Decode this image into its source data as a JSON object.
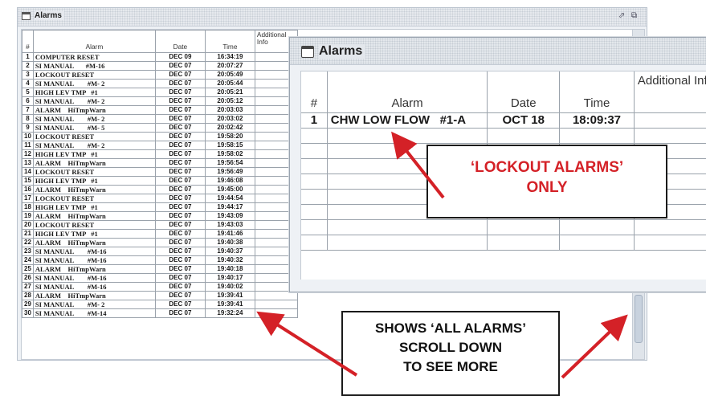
{
  "back_window": {
    "title": "Alarms",
    "controls": {
      "restore": "⬀",
      "maximize": "⧉"
    },
    "columns": [
      "#",
      "Alarm",
      "Date",
      "Time",
      "Additional Info"
    ],
    "rows": [
      [
        "1",
        "COMPUTER RESET",
        "DEC 09",
        "16:34:19"
      ],
      [
        "2",
        "SI MANUAL       #M-16",
        "DEC 07",
        "20:07:27"
      ],
      [
        "3",
        "LOCKOUT RESET",
        "DEC 07",
        "20:05:49"
      ],
      [
        "4",
        "SI MANUAL        #M- 2",
        "DEC 07",
        "20:05:44"
      ],
      [
        "5",
        "HIGH LEV TMP   #1",
        "DEC 07",
        "20:05:21"
      ],
      [
        "6",
        "SI MANUAL        #M- 2",
        "DEC 07",
        "20:05:12"
      ],
      [
        "7",
        "ALARM    HiTmpWarn",
        "DEC 07",
        "20:03:03"
      ],
      [
        "8",
        "SI MANUAL        #M- 2",
        "DEC 07",
        "20:03:02"
      ],
      [
        "9",
        "SI MANUAL        #M- 5",
        "DEC 07",
        "20:02:42"
      ],
      [
        "10",
        "LOCKOUT RESET",
        "DEC 07",
        "19:58:20"
      ],
      [
        "11",
        "SI MANUAL        #M- 2",
        "DEC 07",
        "19:58:15"
      ],
      [
        "12",
        "HIGH LEV TMP   #1",
        "DEC 07",
        "19:58:02"
      ],
      [
        "13",
        "ALARM    HiTmpWarn",
        "DEC 07",
        "19:56:54"
      ],
      [
        "14",
        "LOCKOUT RESET",
        "DEC 07",
        "19:56:49"
      ],
      [
        "15",
        "HIGH LEV TMP   #1",
        "DEC 07",
        "19:46:08"
      ],
      [
        "16",
        "ALARM    HiTmpWarn",
        "DEC 07",
        "19:45:00"
      ],
      [
        "17",
        "LOCKOUT RESET",
        "DEC 07",
        "19:44:54"
      ],
      [
        "18",
        "HIGH LEV TMP   #1",
        "DEC 07",
        "19:44:17"
      ],
      [
        "19",
        "ALARM    HiTmpWarn",
        "DEC 07",
        "19:43:09"
      ],
      [
        "20",
        "LOCKOUT RESET",
        "DEC 07",
        "19:43:03"
      ],
      [
        "21",
        "HIGH LEV TMP   #1",
        "DEC 07",
        "19:41:46"
      ],
      [
        "22",
        "ALARM    HiTmpWarn",
        "DEC 07",
        "19:40:38"
      ],
      [
        "23",
        "SI MANUAL        #M-16",
        "DEC 07",
        "19:40:37"
      ],
      [
        "24",
        "SI MANUAL        #M-16",
        "DEC 07",
        "19:40:32"
      ],
      [
        "25",
        "ALARM    HiTmpWarn",
        "DEC 07",
        "19:40:18"
      ],
      [
        "26",
        "SI MANUAL        #M-16",
        "DEC 07",
        "19:40:17"
      ],
      [
        "27",
        "SI MANUAL        #M-16",
        "DEC 07",
        "19:40:02"
      ],
      [
        "28",
        "ALARM    HiTmpWarn",
        "DEC 07",
        "19:39:41"
      ],
      [
        "29",
        "SI MANUAL        #M- 2",
        "DEC 07",
        "19:39:41"
      ],
      [
        "30",
        "SI MANUAL        #M-14",
        "DEC 07",
        "19:32:24"
      ]
    ]
  },
  "front_window": {
    "title": "Alarms",
    "columns": [
      "#",
      "Alarm",
      "Date",
      "Time",
      "Additional Info"
    ],
    "rows": [
      [
        "1",
        "CHW LOW FLOW   #1-A",
        "OCT 18",
        "18:09:37"
      ]
    ],
    "empty_rows": 8
  },
  "callouts": {
    "lockout": [
      "‘LOCKOUT ALARMS’",
      "ONLY"
    ],
    "all": [
      "SHOWS ‘ALL ALARMS’",
      "SCROLL DOWN",
      "TO SEE MORE"
    ]
  },
  "colors": {
    "callout_red": "#d42127",
    "arrow_red": "#d42127"
  }
}
